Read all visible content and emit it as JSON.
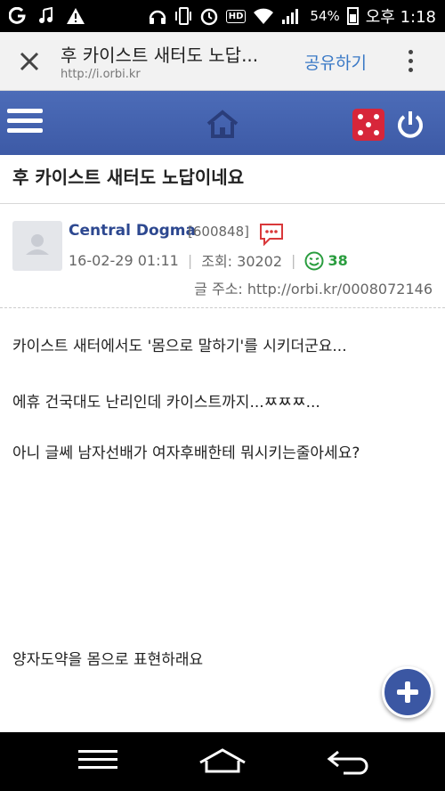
{
  "status_bar": {
    "battery": "54%",
    "time": "오후 1:18",
    "hd_badge": "HD"
  },
  "toolbar": {
    "title": "후 카이스트 새터도 노답...",
    "url": "http://i.orbi.kr",
    "share_label": "공유하기"
  },
  "post": {
    "title": "후 카이스트 새터도 노답이네요",
    "author": "Central Dogma",
    "author_id": "[600848]",
    "date": "16-02-29 01:11",
    "views": "조회: 30202",
    "likes": "38",
    "post_url": "글 주소: http://orbi.kr/0008072146",
    "paragraphs": [
      "카이스트 새터에서도 '몸으로 말하기'를 시키더군요...",
      "에휴 건국대도 난리인데 카이스트까지...ㅉㅉㅉ...",
      "아니 글쎄 남자선배가 여자후배한테 뭐시키는줄아세요?",
      "양자도약을 몸으로 표현하래요"
    ]
  },
  "colors": {
    "header_blue": "#3d5aa6",
    "author_blue": "#2d4890",
    "share_blue": "#3a79c6",
    "like_green": "#2a9d3f",
    "dice_red": "#d7263a"
  }
}
